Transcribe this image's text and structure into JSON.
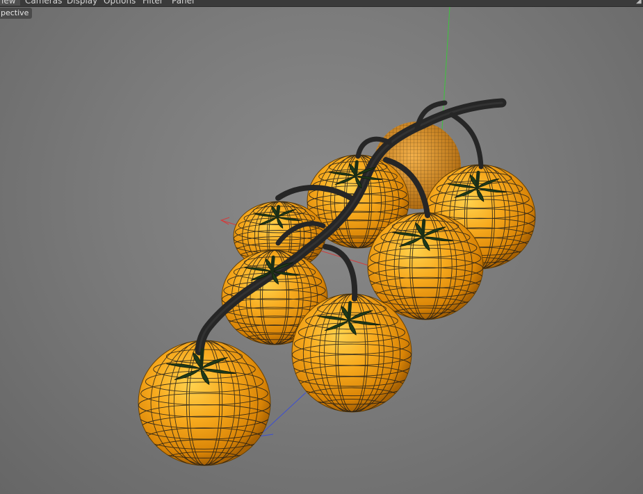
{
  "menubar": {
    "items": [
      {
        "label": "iew",
        "active": true
      },
      {
        "label": "Cameras",
        "active": false
      },
      {
        "label": "Display",
        "active": false
      },
      {
        "label": "Options",
        "active": false
      },
      {
        "label": "Filter",
        "active": false
      },
      {
        "label": "Panel",
        "active": false
      }
    ],
    "resize_icon": "resize-corner-icon"
  },
  "viewport": {
    "camera_label": "pective",
    "object_color": "#f5a623",
    "wire_color": "#1a1a1a",
    "axis_colors": {
      "x": "#d23c3c",
      "y": "#3cc43c",
      "z": "#3c4ed2"
    }
  }
}
